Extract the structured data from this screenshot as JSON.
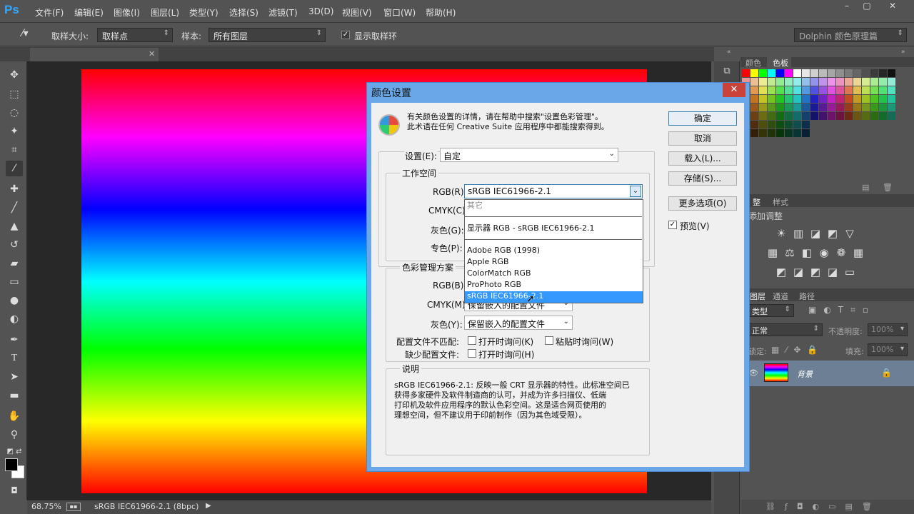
{
  "app": {
    "logo": "Ps",
    "menu": [
      "文件(F)",
      "编辑(E)",
      "图像(I)",
      "图层(L)",
      "类型(Y)",
      "选择(S)",
      "滤镜(T)",
      "3D(D)",
      "视图(V)",
      "窗口(W)",
      "帮助(H)"
    ],
    "window_controls": [
      "–",
      "▢",
      "✕"
    ]
  },
  "options_bar": {
    "sample_size_label": "取样大小:",
    "sample_size_value": "取样点",
    "sample_label": "样本:",
    "sample_value": "所有图层",
    "show_ring_label": "显示取样环",
    "workspace": "Dolphin 颜色原理篇"
  },
  "status_bar": {
    "zoom": "68.75%",
    "doc_info": "sRGB IEC61966-2.1 (8bpc)"
  },
  "panels": {
    "color_tab": "颜色",
    "swatches_tab": "色板",
    "adjust_tab": "整",
    "styles_tab": "样式",
    "adjust_title": "添加调整",
    "layers_tab": "图层",
    "channels_tab": "通道",
    "paths_tab": "路径",
    "filter_label": "类型",
    "blend_mode": "正常",
    "opacity_label": "不透明度:",
    "opacity_value": "100%",
    "lock_label": "锁定:",
    "fill_label": "填充:",
    "fill_value": "100%",
    "layer_name": "背景"
  },
  "dialog": {
    "title": "颜色设置",
    "info_line1": "有关颜色设置的详情，请在帮助中搜索\"设置色彩管理\"。",
    "info_line2": "此术语在任何 Creative Suite 应用程序中都能搜索得到。",
    "settings_label": "设置(E):",
    "settings_value": "自定",
    "workspace_group": "工作空间",
    "rgb_label": "RGB(R):",
    "rgb_value": "sRGB IEC61966-2.1",
    "cmyk_label": "CMYK(C):",
    "gray_label": "灰色(G):",
    "spot_label": "专色(P):",
    "policy_group": "色彩管理方案",
    "policy_rgb_label": "RGB(B):",
    "policy_cmyk_label": "CMYK(M):",
    "policy_cmyk_value": "保留嵌入的配置文件",
    "policy_gray_label": "灰色(Y):",
    "policy_gray_value": "保留嵌入的配置文件",
    "mismatch_label": "配置文件不匹配:",
    "mismatch_open": "打开时询问(K)",
    "mismatch_paste": "粘贴时询问(W)",
    "missing_label": "缺少配置文件:",
    "missing_open": "打开时询问(H)",
    "desc_group": "说明",
    "desc_line1": "sRGB IEC61966-2.1: 反映一般 CRT 显示器的特性。此标准空间已",
    "desc_line2": "获得多家硬件及软件制造商的认可，并成为许多扫描仪、低端",
    "desc_line3": "打印机及软件应用程序的默认色彩空间。这是适合网页使用的",
    "desc_line4": "理想空间，但不建议用于印前制作（因为其色域受限）。",
    "ok": "确定",
    "cancel": "取消",
    "load": "载入(L)...",
    "save": "存储(S)...",
    "more_options": "更多选项(O)",
    "preview": "预览(V)",
    "dropdown": {
      "other": "其它",
      "monitor": "显示器 RGB - sRGB IEC61966-2.1",
      "items": [
        "Adobe RGB (1998)",
        "Apple RGB",
        "ColorMatch RGB",
        "ProPhoto RGB",
        "sRGB IEC61966-2.1"
      ]
    }
  }
}
